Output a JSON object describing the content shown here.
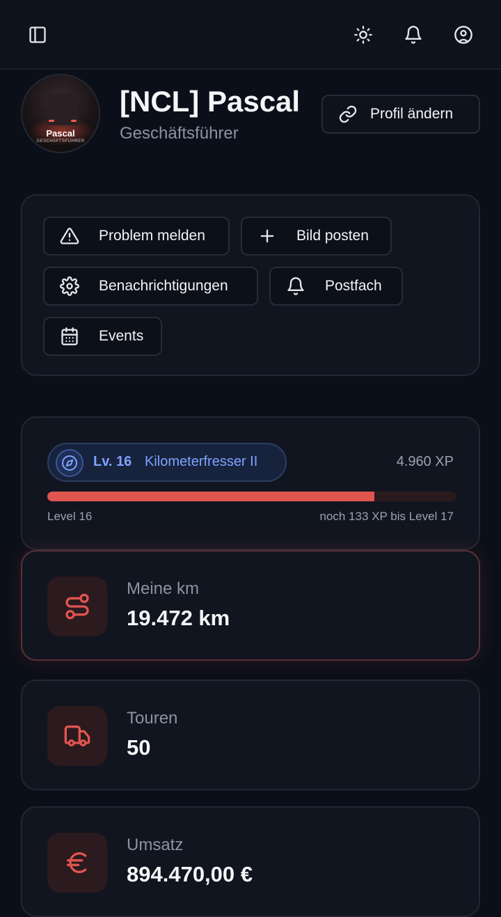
{
  "topbar": {
    "sidebar_icon": "sidebar-toggle-icon",
    "theme_icon": "sun-icon",
    "notifications_icon": "bell-icon",
    "account_icon": "user-circle-icon"
  },
  "profile": {
    "name": "[NCL] Pascal",
    "role": "Geschäftsführer",
    "avatar_name": "Pascal",
    "avatar_role": "GESCHÄFTSFÜHRER",
    "edit_label": "Profil ändern"
  },
  "actions": [
    {
      "label": "Problem melden",
      "icon": "warning-icon"
    },
    {
      "label": "Bild posten",
      "icon": "plus-icon"
    },
    {
      "label": "Benachrichtigungen",
      "icon": "gear-icon"
    },
    {
      "label": "Postfach",
      "icon": "bell-icon"
    },
    {
      "label": "Events",
      "icon": "calendar-icon"
    }
  ],
  "level": {
    "level_label": "Lv. 16",
    "title": "Kilometerfresser II",
    "xp_total": "4.960 XP",
    "progress": 0.8,
    "left_label": "Level 16",
    "right_label": "noch 133 XP bis Level 17"
  },
  "stats": [
    {
      "label": "Meine km",
      "value": "19.472 km",
      "icon": "route-icon"
    },
    {
      "label": "Touren",
      "value": "50",
      "icon": "truck-icon"
    },
    {
      "label": "Umsatz",
      "value": "894.470,00 €",
      "icon": "euro-icon"
    }
  ],
  "colors": {
    "background": "#0b0f19",
    "accent_red": "#e05550",
    "accent_blue": "#7ea3ff",
    "card": "#11151f"
  }
}
